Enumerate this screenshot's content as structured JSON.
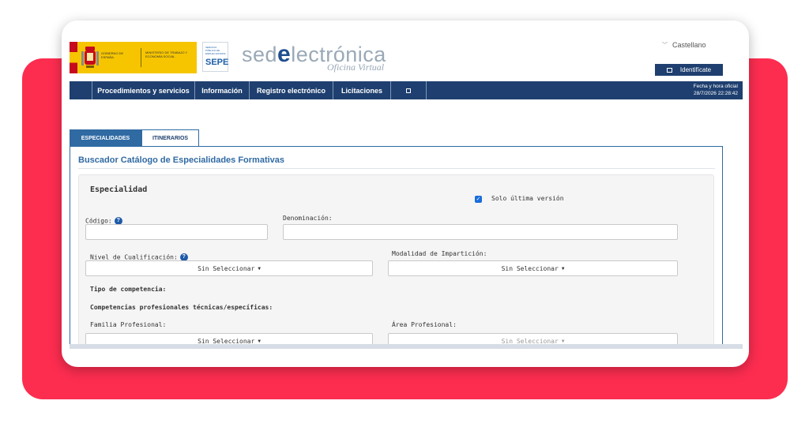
{
  "header": {
    "gov_text": "GOBIERNO DE ESPAÑA",
    "ministry_text": "MINISTERIO DE TRABAJO Y ECONOMÍA SOCIAL",
    "sepe_small": "SERVICIO PÚBLICO DE EMPLEO ESTATAL",
    "sepe_big": "SEPE",
    "brand_pre": "sed",
    "brand_e": "e",
    "brand_post": "lectrónica",
    "brand_sub": "Oficina Virtual",
    "language": "Castellano",
    "login_label": "Identifícate"
  },
  "nav": {
    "items": [
      {
        "label": "Procedimientos y servicios"
      },
      {
        "label": "Información"
      },
      {
        "label": "Registro electrónico"
      },
      {
        "label": "Licitaciones"
      }
    ],
    "datetime_label": "Fecha y hora oficial",
    "datetime_value": "28/7/2026 22:28:42"
  },
  "tabs": [
    {
      "label": "ESPECIALIDADES",
      "active": true
    },
    {
      "label": "ITINERARIOS",
      "active": false
    }
  ],
  "panel": {
    "title": "Buscador Catálogo de Especialidades Formativas",
    "section_title": "Especialidad",
    "checkbox_label": "Solo última versión",
    "checkbox_checked": true,
    "codigo_label": "Código:",
    "denominacion_label": "Denominación:",
    "nivel_label": "Nivel de Cualificación:",
    "modalidad_label": "Modalidad de Impartición:",
    "tipo_label": "Tipo de competencia:",
    "competencias_label": "Competencias profesionales técnicas/específicas:",
    "familia_label": "Familia Profesional:",
    "area_label": "Área Profesional:",
    "select_default": "Sin Seleccionar"
  },
  "colors": {
    "accent_red": "#fd2d50",
    "navbar": "#1e3f6f",
    "tab_active": "#306aa3"
  },
  "icons": {
    "info": "question-circle-icon",
    "language_toggle": "chevron-down-icon",
    "login": "square-icon",
    "nav_extra": "square-icon"
  }
}
